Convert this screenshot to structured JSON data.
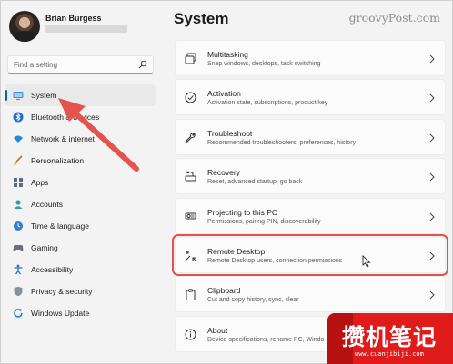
{
  "user": {
    "name": "Brian Burgess"
  },
  "search": {
    "placeholder": "Find a setting",
    "icon": "search-icon"
  },
  "nav": [
    {
      "label": "System",
      "icon": "monitor-icon",
      "active": true
    },
    {
      "label": "Bluetooth & devices",
      "icon": "bluetooth-icon"
    },
    {
      "label": "Network & internet",
      "icon": "wifi-icon"
    },
    {
      "label": "Personalization",
      "icon": "brush-icon"
    },
    {
      "label": "Apps",
      "icon": "apps-icon"
    },
    {
      "label": "Accounts",
      "icon": "person-icon"
    },
    {
      "label": "Time & language",
      "icon": "globe-clock-icon"
    },
    {
      "label": "Gaming",
      "icon": "gamepad-icon"
    },
    {
      "label": "Accessibility",
      "icon": "accessibility-icon"
    },
    {
      "label": "Privacy & security",
      "icon": "shield-icon"
    },
    {
      "label": "Windows Update",
      "icon": "update-icon"
    }
  ],
  "page": {
    "title": "System",
    "watermark": "groovyPost.com"
  },
  "cards": [
    {
      "title": "Multitasking",
      "desc": "Snap windows, desktops, task switching",
      "icon": "multitasking-icon"
    },
    {
      "title": "Activation",
      "desc": "Activation state, subscriptions, product key",
      "icon": "check-circle-icon"
    },
    {
      "title": "Troubleshoot",
      "desc": "Recommended troubleshooters, preferences, history",
      "icon": "wrench-icon"
    },
    {
      "title": "Recovery",
      "desc": "Reset, advanced startup, go back",
      "icon": "recovery-icon"
    },
    {
      "title": "Projecting to this PC",
      "desc": "Permissions, pairing PIN, discoverability",
      "icon": "projector-icon"
    },
    {
      "title": "Remote Desktop",
      "desc": "Remote Desktop users, connection permissions",
      "icon": "remote-desktop-icon",
      "highlighted": true
    },
    {
      "title": "Clipboard",
      "desc": "Cut and copy history, sync, clear",
      "icon": "clipboard-icon"
    },
    {
      "title": "About",
      "desc": "Device specifications, rename PC, Windo",
      "icon": "info-icon"
    }
  ],
  "logo": {
    "text": "攒机笔记",
    "url": "www.cuanjibiji.com"
  },
  "colors": {
    "accent": "#0067c0",
    "highlight": "#e0524b",
    "logo": "#e01b1b"
  }
}
